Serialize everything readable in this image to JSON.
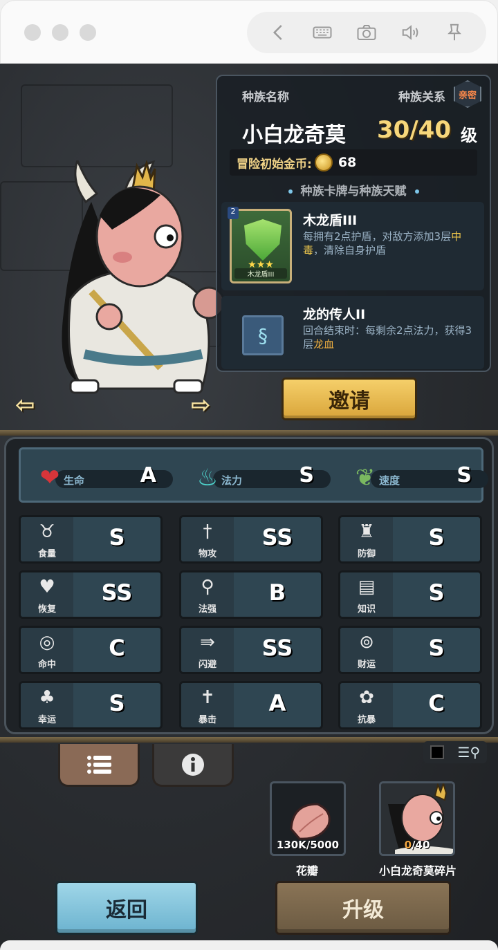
{
  "browser": {
    "icons": [
      "back-icon",
      "keyboard-icon",
      "camera-icon",
      "volume-icon",
      "pin-icon"
    ]
  },
  "race": {
    "name_label": "种族名称",
    "relation_label": "种族关系",
    "relation_value": "亲密",
    "name": "小白龙奇莫",
    "level": "30/40",
    "level_unit": "级",
    "coin_label": "冒险初始金币:",
    "coin_value": "68",
    "section_title": "种族卡牌与种族天赋"
  },
  "talents": [
    {
      "title": "木龙盾III",
      "card_name": "木龙盾III",
      "card_badge": "2",
      "desc_plain": "每拥有2点护盾，对敌方添加3层",
      "desc_highlight": "中毒",
      "desc_tail": "，清除自身护盾"
    },
    {
      "title": "龙的传人II",
      "desc_plain": "回合结束时：每剩余2点法力，获得3层",
      "desc_highlight": "龙血",
      "desc_tail": ""
    }
  ],
  "invite_label": "邀请",
  "main_stats": [
    {
      "label": "生命",
      "grade": "A",
      "icon": "heart-icon"
    },
    {
      "label": "法力",
      "grade": "S",
      "icon": "flame-icon"
    },
    {
      "label": "速度",
      "grade": "S",
      "icon": "boot-icon"
    }
  ],
  "stats": [
    {
      "label": "食量",
      "grade": "S",
      "icon": "stomach-icon"
    },
    {
      "label": "物攻",
      "grade": "SS",
      "icon": "sword-icon"
    },
    {
      "label": "防御",
      "grade": "S",
      "icon": "armor-icon"
    },
    {
      "label": "恢复",
      "grade": "SS",
      "icon": "heart-plus-icon"
    },
    {
      "label": "法强",
      "grade": "B",
      "icon": "staff-icon"
    },
    {
      "label": "知识",
      "grade": "S",
      "icon": "book-icon"
    },
    {
      "label": "命中",
      "grade": "C",
      "icon": "target-icon"
    },
    {
      "label": "闪避",
      "grade": "SS",
      "icon": "dodge-icon"
    },
    {
      "label": "财运",
      "grade": "S",
      "icon": "coin-ring-icon"
    },
    {
      "label": "幸运",
      "grade": "S",
      "icon": "clover-icon"
    },
    {
      "label": "暴击",
      "grade": "A",
      "icon": "crit-icon"
    },
    {
      "label": "抗暴",
      "grade": "C",
      "icon": "shield-flower-icon"
    }
  ],
  "items": [
    {
      "label": "花瓣",
      "count": "130K/5000",
      "icon": "petal-icon"
    },
    {
      "label": "小白龙奇莫碎片",
      "count_current": "0",
      "count_total": "/40",
      "icon": "character-portrait-icon"
    }
  ],
  "buttons": {
    "back": "返回",
    "upgrade": "升级"
  },
  "colors": {
    "gold": "#f7d77b",
    "highlight": "#f2c94c",
    "panel": "#2f4652",
    "back_btn": "#9fd6e8",
    "upgrade_btn": "#8a7456"
  }
}
